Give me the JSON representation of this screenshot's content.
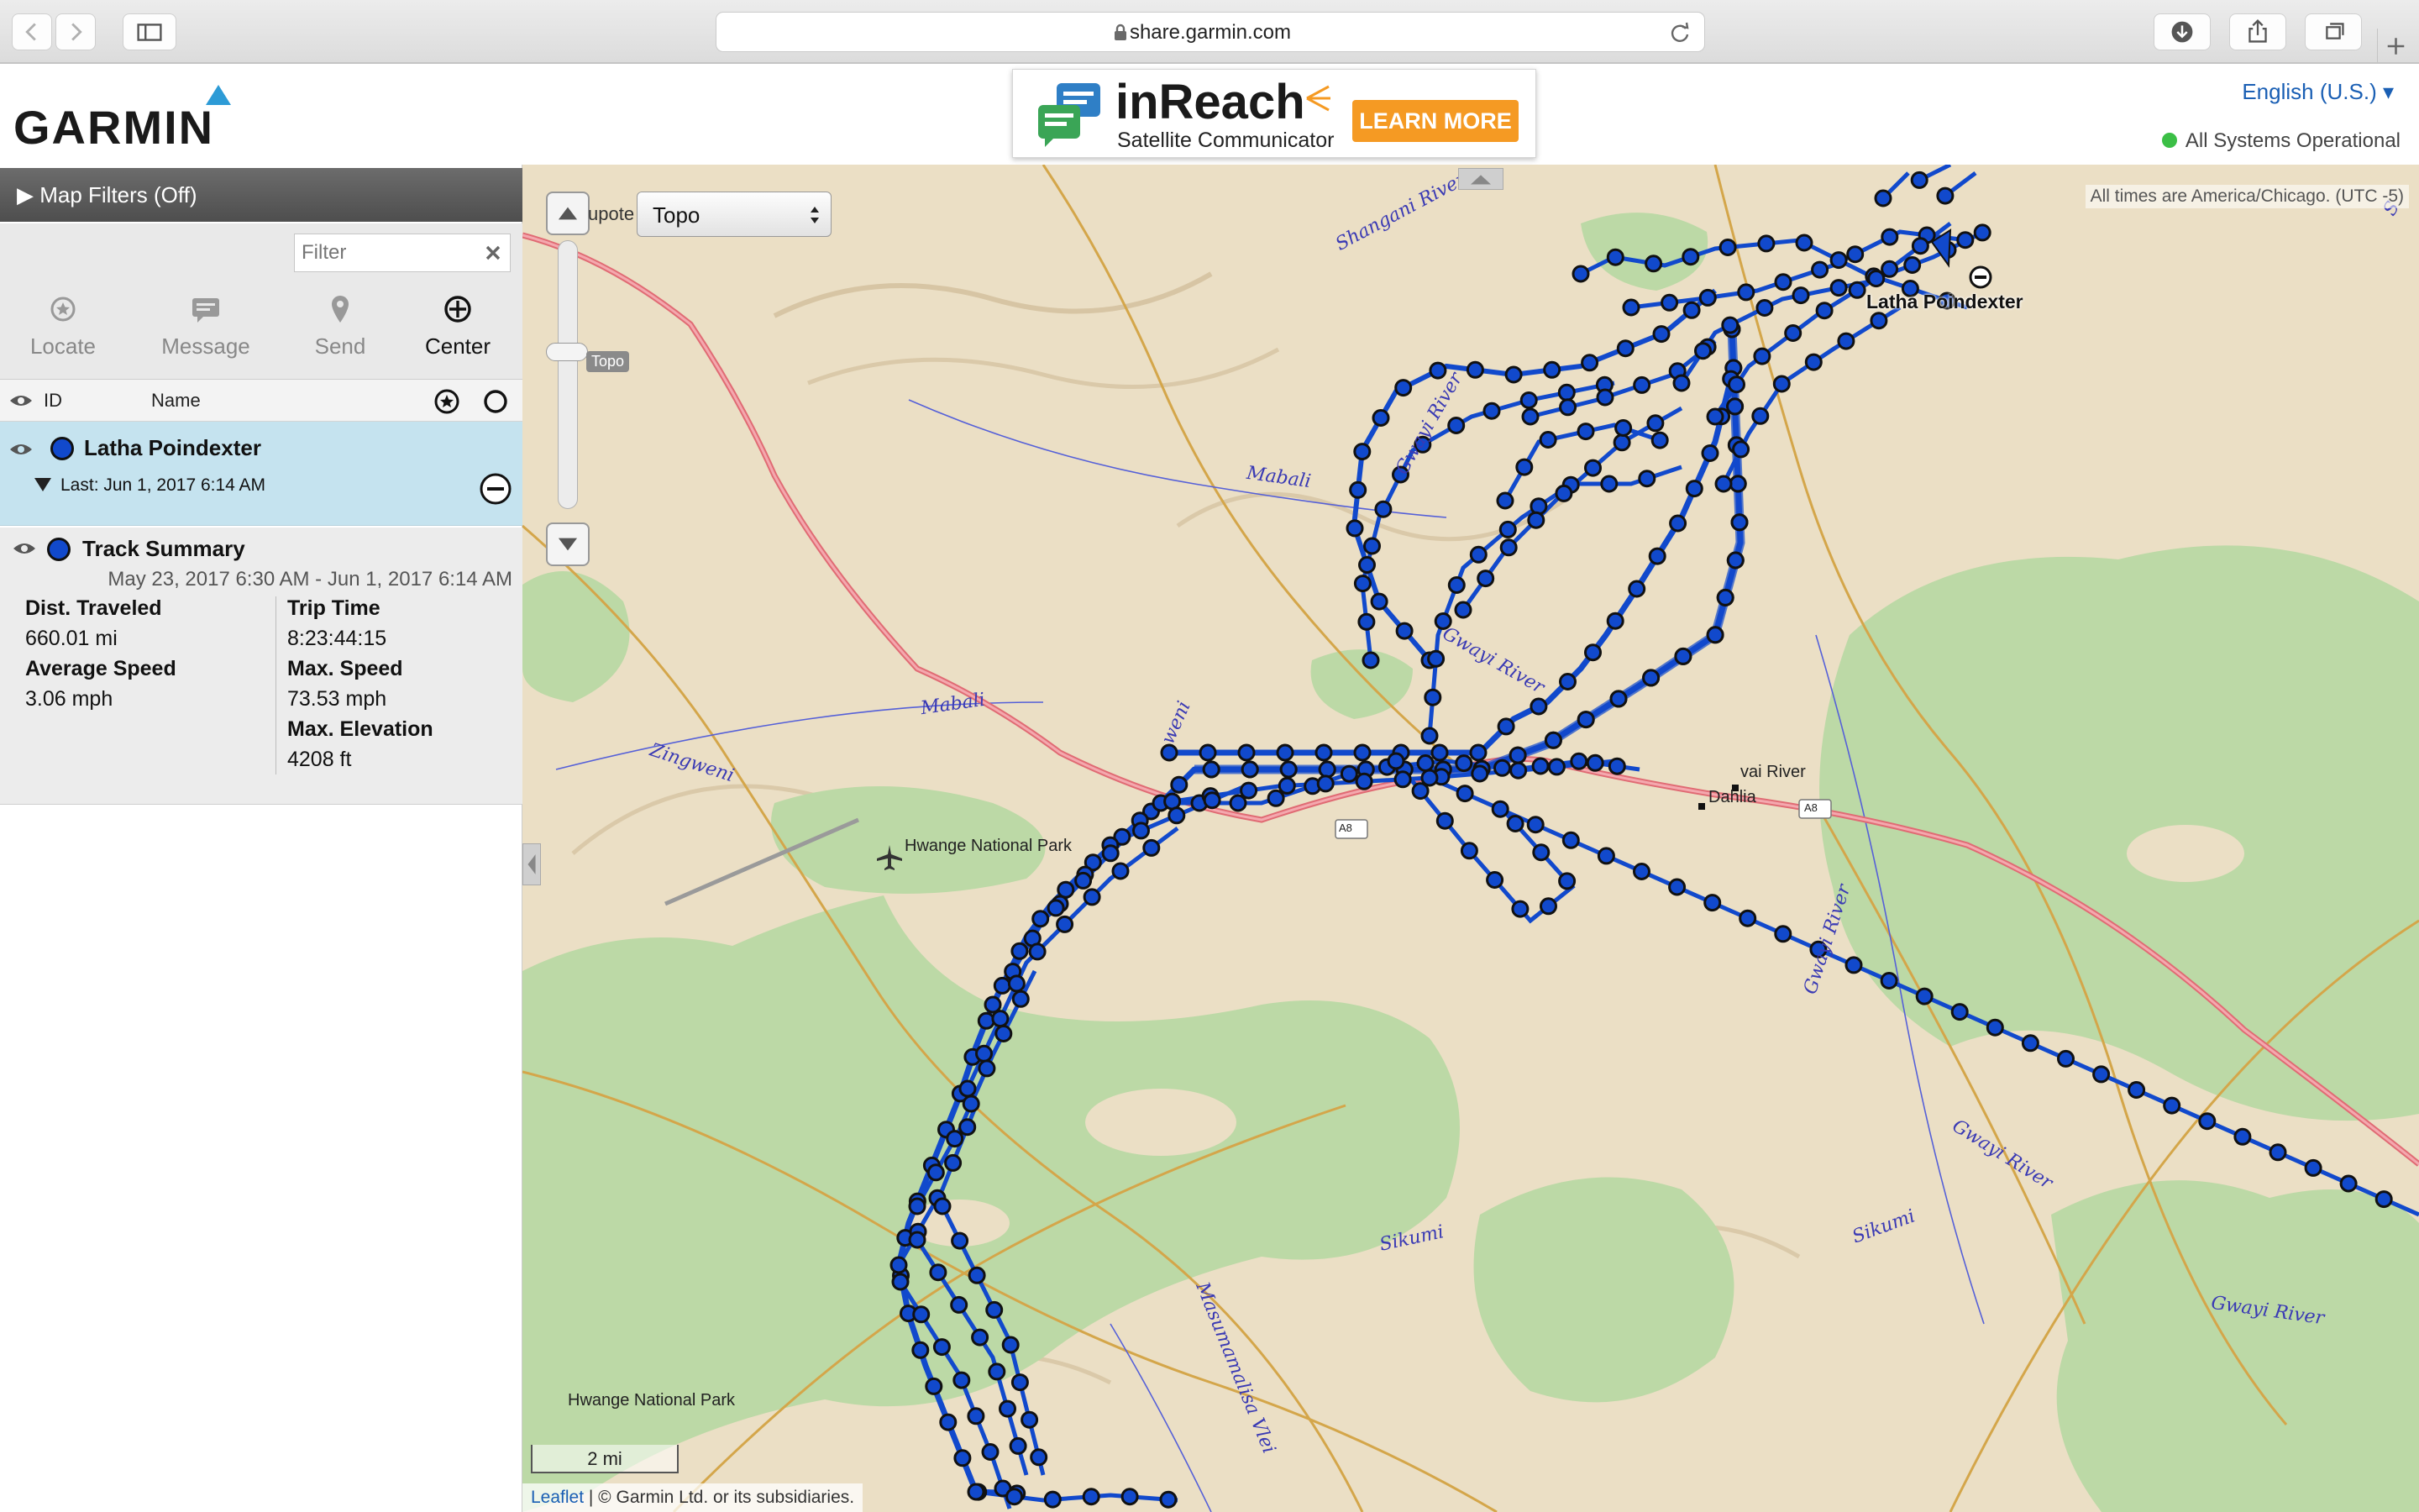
{
  "browser": {
    "url": "share.garmin.com"
  },
  "header": {
    "logo_text": "GARMIN",
    "ad": {
      "brand": "inReach",
      "subtitle": "Satellite Communicator",
      "cta": "LEARN MORE"
    },
    "language": "English (U.S.) ▾",
    "system_status": "All Systems Operational",
    "status_color": "#3bbf46"
  },
  "sidebar": {
    "map_filters": "▶ Map Filters (Off)",
    "filter_placeholder": "Filter",
    "actions": [
      "Locate",
      "Message",
      "Send",
      "Center"
    ],
    "list_header": {
      "id": "ID",
      "name": "Name"
    },
    "user": {
      "name": "Latha Poindexter",
      "last": "Last: Jun 1, 2017 6:14 AM"
    },
    "track_summary": {
      "title": "Track Summary",
      "range": "May 23, 2017 6:30 AM - Jun 1, 2017 6:14 AM",
      "dist_label": "Dist. Traveled",
      "dist_value": "660.01 mi",
      "avg_label": "Average Speed",
      "avg_value": "3.06 mph",
      "trip_label": "Trip Time",
      "trip_value": "8:23:44:15",
      "max_speed_label": "Max. Speed",
      "max_speed_value": "73.53 mph",
      "max_elev_label": "Max. Elevation",
      "max_elev_value": "4208 ft"
    }
  },
  "map": {
    "type_prefix": "upote",
    "map_type": "Topo",
    "zoom_tip": "Topo",
    "timezone_note": "All times are America/Chicago. (UTC -5)",
    "scale": "2 mi",
    "attribution_link": "Leaflet",
    "attribution_text": " | © Garmin Ltd. or its subsidiaries.",
    "track_color": "#1149cc",
    "road_color": "#e06b74",
    "labels": {
      "shangani": "Shangani River",
      "gwayi_top": "Gwayi River",
      "mabali_a": "Mabali",
      "mabali_b": "Mabali",
      "zingweni": "Zingweni",
      "gwayi_mid": "Gwayi River",
      "gwayi_right": "Gwayi River",
      "gwayi_right2": "Gwayi River",
      "gwayi_far": "Gwayi River",
      "sikumi_a": "Sikumi",
      "sikumi_b": "Sikumi",
      "masuma": "Masumamalisa Vlei",
      "zweni": "weni",
      "corner": "S",
      "gwayi_village": "vai River",
      "dahlia": "Dahlia",
      "hwange_np": "Hwange National Park",
      "hwange_np2": "Hwange National Park",
      "latha": "Latha Poindexter",
      "shield_a8": "A8",
      "shield_a8b": "A8"
    }
  }
}
